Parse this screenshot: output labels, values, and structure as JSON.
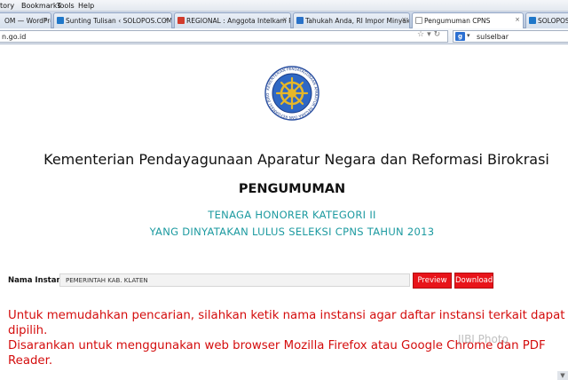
{
  "menu": [
    "tory",
    "Bookmarks",
    "Tools",
    "Help"
  ],
  "tabs": [
    {
      "label": "OM — WordPress",
      "icon": "wordpress-icon",
      "color": "#3a6da8"
    },
    {
      "label": "Sunting Tulisan ‹ SOLOPOS.COM — ...",
      "icon": "solopos-icon",
      "color": "#1f77c9"
    },
    {
      "label": "REGIONAL : Anggota Intelkam Pold...",
      "icon": "gmail-icon",
      "color": "#d23b2c"
    },
    {
      "label": "Tahukah Anda, RI Impor Minyak Me...",
      "icon": "news-icon",
      "color": "#2a72c8"
    },
    {
      "label": "Pengumuman CPNS",
      "icon": "page-icon",
      "color": "#ffffff"
    },
    {
      "label": "SOLOPOS.COM",
      "icon": "solopos-icon",
      "color": "#1f77c9"
    }
  ],
  "address": "n.go.id",
  "search": {
    "value": "sulselbar",
    "engine_letter": "g"
  },
  "page": {
    "ministry": "Kementerian Pendayagunaan Aparatur Negara dan Reformasi Birokrasi",
    "announce": "PENGUMUMAN",
    "subtitle1": "TENAGA HONORER KATEGORI II",
    "subtitle2": "YANG DINYATAKAN LULUS SELEKSI CPNS TAHUN 2013",
    "instansi_label": "Nama Instansi",
    "instansi_value": "PEMERINTAH KAB. KLATEN",
    "preview_label": "Preview",
    "download_label": "Download",
    "notice1": "Untuk memudahkan pencarian, silahkan ketik nama instansi agar daftar instansi terkait dapat dipilih.",
    "notice2": "Disarankan untuk menggunakan web browser Mozilla Firefox atau Google Chrome dan PDF Reader.",
    "watermark": "JIBI Photo",
    "logo_text": "KEMENTERIAN PENDAYAGUNAAN APARATUR NEGARA DAN REFORMASI BIROKRASI"
  },
  "colors": {
    "accent_red": "#e8141a",
    "teal": "#1c9aa0",
    "notice_red": "#d40d0d"
  }
}
